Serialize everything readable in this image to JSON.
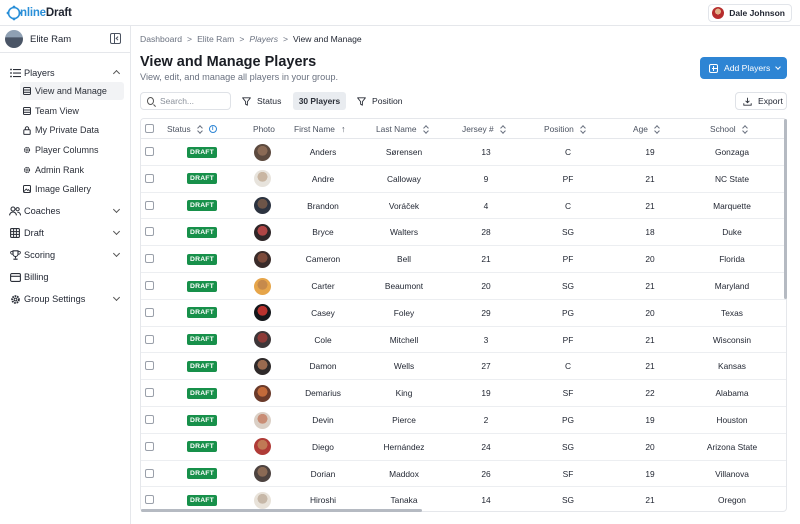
{
  "app": {
    "logo_prefix": "O",
    "logo_online": "nline",
    "logo_draft": "Draft"
  },
  "user": {
    "name": "Dale Johnson"
  },
  "sidebar": {
    "group_name": "Elite Ram",
    "nav": [
      {
        "label": "Players",
        "icon": "list-icon",
        "expanded": true
      },
      {
        "label": "Coaches",
        "icon": "users-icon"
      },
      {
        "label": "Draft",
        "icon": "grid-icon"
      },
      {
        "label": "Scoring",
        "icon": "trophy-icon"
      },
      {
        "label": "Billing",
        "icon": "card-icon"
      },
      {
        "label": "Group Settings",
        "icon": "gear-icon"
      }
    ],
    "sub": [
      {
        "label": "View and Manage",
        "icon": "table-icon",
        "active": true
      },
      {
        "label": "Team View",
        "icon": "table-icon"
      },
      {
        "label": "My Private Data",
        "icon": "lock-icon"
      },
      {
        "label": "Player Columns",
        "icon": "gear-icon"
      },
      {
        "label": "Admin Rank",
        "icon": "gear-icon"
      },
      {
        "label": "Image Gallery",
        "icon": "image-icon"
      }
    ]
  },
  "breadcrumb": [
    "Dashboard",
    "Elite Ram",
    "Players",
    "View and Manage"
  ],
  "page": {
    "title": "View and Manage Players",
    "subtitle": "View, edit, and manage all players in your group."
  },
  "actions": {
    "add_players": "Add Players",
    "export": "Export"
  },
  "toolbar": {
    "search_placeholder": "Search...",
    "status_filter": "Status",
    "player_count": "30 Players",
    "position_filter": "Position"
  },
  "table": {
    "columns": [
      "Status",
      "Photo",
      "First Name",
      "Last Name",
      "Jersey #",
      "Position",
      "Age",
      "School"
    ],
    "rows": [
      {
        "status": "DRAFT",
        "first": "Anders",
        "last": "Sørensen",
        "jersey": "13",
        "pos": "C",
        "age": "19",
        "school": "Gonzaga",
        "skin": "#8a6a55",
        "bg": "#5c4a3f"
      },
      {
        "status": "DRAFT",
        "first": "Andre",
        "last": "Calloway",
        "jersey": "9",
        "pos": "PF",
        "age": "21",
        "school": "NC State",
        "skin": "#c9b6a2",
        "bg": "#e7e3dc"
      },
      {
        "status": "DRAFT",
        "first": "Brandon",
        "last": "Voráček",
        "jersey": "4",
        "pos": "C",
        "age": "21",
        "school": "Marquette",
        "skin": "#6d5548",
        "bg": "#2c3340"
      },
      {
        "status": "DRAFT",
        "first": "Bryce",
        "last": "Walters",
        "jersey": "28",
        "pos": "SG",
        "age": "18",
        "school": "Duke",
        "skin": "#b04545",
        "bg": "#2f2628"
      },
      {
        "status": "DRAFT",
        "first": "Cameron",
        "last": "Bell",
        "jersey": "21",
        "pos": "PF",
        "age": "20",
        "school": "Florida",
        "skin": "#7d4b3b",
        "bg": "#3a2c2a"
      },
      {
        "status": "DRAFT",
        "first": "Carter",
        "last": "Beaumont",
        "jersey": "20",
        "pos": "SG",
        "age": "21",
        "school": "Maryland",
        "skin": "#c68a4c",
        "bg": "#e6a54a"
      },
      {
        "status": "DRAFT",
        "first": "Casey",
        "last": "Foley",
        "jersey": "29",
        "pos": "PG",
        "age": "20",
        "school": "Texas",
        "skin": "#b8322e",
        "bg": "#15171b"
      },
      {
        "status": "DRAFT",
        "first": "Cole",
        "last": "Mitchell",
        "jersey": "3",
        "pos": "PF",
        "age": "21",
        "school": "Wisconsin",
        "skin": "#8e3a37",
        "bg": "#3d3638"
      },
      {
        "status": "DRAFT",
        "first": "Damon",
        "last": "Wells",
        "jersey": "27",
        "pos": "C",
        "age": "21",
        "school": "Kansas",
        "skin": "#9a6a4f",
        "bg": "#2f2a2a"
      },
      {
        "status": "DRAFT",
        "first": "Demarius",
        "last": "King",
        "jersey": "19",
        "pos": "SF",
        "age": "22",
        "school": "Alabama",
        "skin": "#c26a3a",
        "bg": "#6a3a2a"
      },
      {
        "status": "DRAFT",
        "first": "Devin",
        "last": "Pierce",
        "jersey": "2",
        "pos": "PG",
        "age": "19",
        "school": "Houston",
        "skin": "#c98d75",
        "bg": "#dacfc5"
      },
      {
        "status": "DRAFT",
        "first": "Diego",
        "last": "Hernández",
        "jersey": "24",
        "pos": "SG",
        "age": "20",
        "school": "Arizona State",
        "skin": "#c07a55",
        "bg": "#b03c37"
      },
      {
        "status": "DRAFT",
        "first": "Dorian",
        "last": "Maddox",
        "jersey": "26",
        "pos": "SF",
        "age": "19",
        "school": "Villanova",
        "skin": "#8a6a55",
        "bg": "#4d4340"
      },
      {
        "status": "DRAFT",
        "first": "Hiroshi",
        "last": "Tanaka",
        "jersey": "14",
        "pos": "SG",
        "age": "21",
        "school": "Oregon",
        "skin": "#c7b8a8",
        "bg": "#e8e2d9"
      }
    ]
  },
  "colors": {
    "accent": "#2e85d4",
    "badge": "#17904a"
  }
}
